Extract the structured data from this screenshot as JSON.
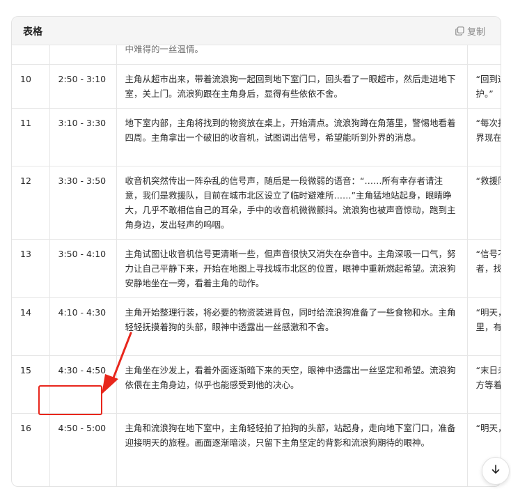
{
  "card": {
    "title": "表格",
    "copy_label": "复制"
  },
  "rows": [
    {
      "num": "",
      "time": "",
      "desc": "中难得的一丝温情。",
      "line": ""
    },
    {
      "num": "10",
      "time": "2:50 - 3:10",
      "desc": "主角从超市出来，带着流浪狗一起回到地下室门口，回头看了一眼超市，然后走进地下室，关上门。流浪狗跟在主角身后，显得有些依依不舍。",
      "line": "“回到这\n护。”"
    },
    {
      "num": "11",
      "time": "3:10 - 3:30",
      "desc": "地下室内部，主角将找到的物资放在桌上，开始清点。流浪狗蹲在角落里，警惕地看着四周。主角拿出一个破旧的收音机，试图调出信号，希望能听到外界的消息。",
      "line": "“每次打\n界现在"
    },
    {
      "num": "12",
      "time": "3:30 - 3:50",
      "desc": "收音机突然传出一阵杂乱的信号声，随后是一段微弱的语音：“……所有幸存者请注意，我们是救援队，目前在城市北区设立了临时避难所……”主角猛地站起身，眼睛睁大，几乎不敢相信自己的耳朵，手中的收音机微微颤抖。流浪狗也被声音惊动，跑到主角身边，发出轻声的呜咽。",
      "line": "“救援队"
    },
    {
      "num": "13",
      "time": "3:50 - 4:10",
      "desc": "主角试图让收音机信号更清晰一些，但声音很快又消失在杂音中。主角深吸一口气，努力让自己平静下来，开始在地图上寻找城市北区的位置，眼神中重新燃起希望。流浪狗安静地坐在一旁，看着主角的动作。",
      "line": "“信号不\n者，找"
    },
    {
      "num": "14",
      "time": "4:10 - 4:30",
      "desc": "主角开始整理行装，将必要的物资装进背包，同时给流浪狗准备了一些食物和水。主角轻轻抚摸着狗的头部，眼神中透露出一丝感激和不舍。",
      "line": "“明天，\n里，有"
    },
    {
      "num": "15",
      "time": "4:30 - 4:50",
      "desc": "主角坐在沙发上，看着外面逐渐暗下来的天空，眼神中透露出一丝坚定和希望。流浪狗依偎在主角身边，似乎也能感受到他的决心。",
      "line": "“末日未\n方等着"
    },
    {
      "num": "16",
      "time": "4:50 - 5:00",
      "desc": "主角和流浪狗在地下室中，主角轻轻拍了拍狗的头部，站起身，走向地下室门口，准备迎接明天的旅程。画面逐渐暗淡，只留下主角坚定的背影和流浪狗期待的眼神。",
      "line": "“明天，"
    }
  ],
  "annotation": {
    "highlight_color": "#e8261c",
    "highlight_row_num": "16"
  },
  "icons": {
    "copy": "copy-icon",
    "scroll": "arrow-down-icon"
  }
}
